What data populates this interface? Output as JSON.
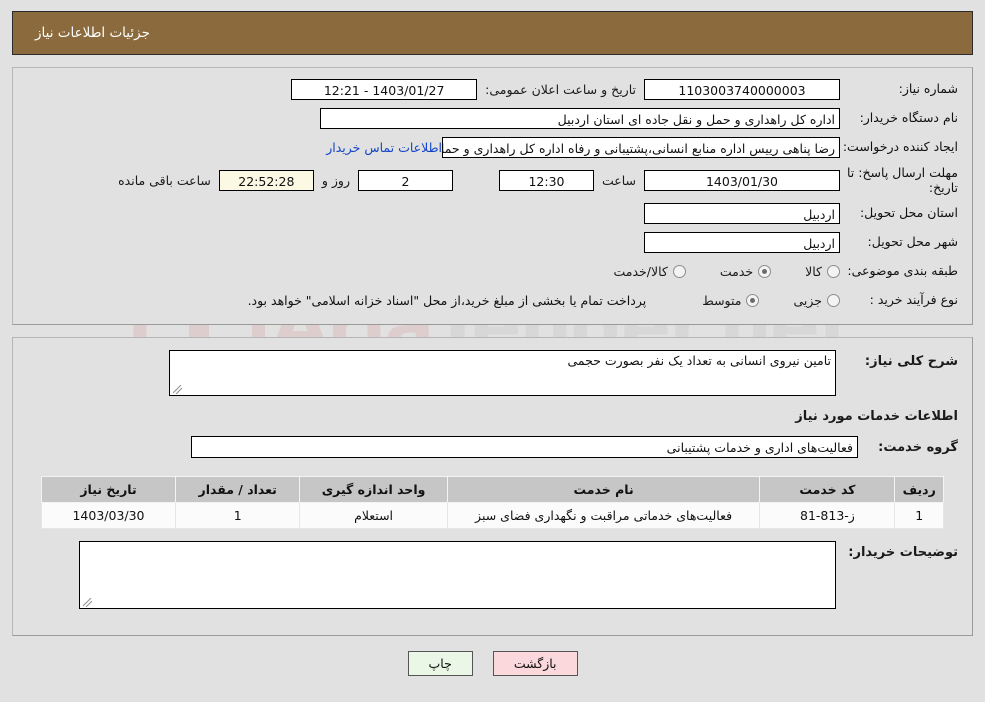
{
  "header": {
    "title": "جزئیات اطلاعات نیاز"
  },
  "form": {
    "need_number_label": "شماره نیاز:",
    "need_number_value": "1103003740000003",
    "announce_label": "تاریخ و ساعت اعلان عمومی:",
    "announce_value": "1403/01/27 - 12:21",
    "buyer_org_label": "نام دستگاه خریدار:",
    "buyer_org_value": "اداره کل راهداری و حمل و نقل جاده ای استان اردبیل",
    "creator_label": "ایجاد کننده درخواست:",
    "creator_value": "رضا پناهی رییس اداره منابع انسانی،پشتیبانی و رفاه اداره کل راهداری و حمل و",
    "contact_link": "اطلاعات تماس خریدار",
    "deadline_label": "مهلت ارسال پاسخ: تا تاریخ:",
    "deadline_date": "1403/01/30",
    "hour_label": "ساعت",
    "deadline_time": "12:30",
    "days_value": "2",
    "days_label": "روز و",
    "timer_value": "22:52:28",
    "remaining_label": "ساعت باقی مانده",
    "province_label": "استان محل تحویل:",
    "province_value": "اردبیل",
    "city_label": "شهر محل تحویل:",
    "city_value": "اردبیل",
    "category_label": "طبقه بندی موضوعی:",
    "category_options": [
      {
        "label": "کالا",
        "selected": false
      },
      {
        "label": "خدمت",
        "selected": true
      },
      {
        "label": "کالا/خدمت",
        "selected": false
      }
    ],
    "process_label": "نوع فرآیند خرید :",
    "process_options": [
      {
        "label": "جزیی",
        "selected": false
      },
      {
        "label": "متوسط",
        "selected": true
      }
    ],
    "process_note": "پرداخت تمام یا بخشی از مبلغ خرید،از محل \"اسناد خزانه اسلامی\" خواهد بود."
  },
  "details": {
    "general_desc_label": "شرح کلی نیاز:",
    "general_desc_value": "تامین نیروی انسانی به تعداد یک نفر بصورت حجمی",
    "services_section_title": "اطلاعات خدمات مورد نیاز",
    "service_group_label": "گروه خدمت:",
    "service_group_value": "فعالیت‌های اداری و خدمات پشتیبانی",
    "buyer_notes_label": "توضیحات خریدار:",
    "buyer_notes_value": ""
  },
  "table": {
    "columns": [
      "ردیف",
      "کد خدمت",
      "نام خدمت",
      "واحد اندازه گیری",
      "تعداد / مقدار",
      "تاریخ نیاز"
    ],
    "rows": [
      {
        "radif": "1",
        "code": "ز-813-81",
        "name": "فعالیت‌های خدماتی مراقبت و نگهداری فضای سبز",
        "unit": "استعلام",
        "qty": "1",
        "date": "1403/03/30"
      }
    ]
  },
  "buttons": {
    "back": "بازگشت",
    "print": "چاپ"
  },
  "watermark": {
    "text_left": "Aria",
    "text_right": "Tender.net"
  },
  "colors": {
    "header_bar": "#8b6b3d",
    "page_background": "#e1e1e1",
    "link": "#1445c8",
    "timer_background": "#fbf8e3",
    "back_button": "#fbd8dc",
    "print_button": "#eaf7e6",
    "table_header": "#c6c6c6"
  }
}
